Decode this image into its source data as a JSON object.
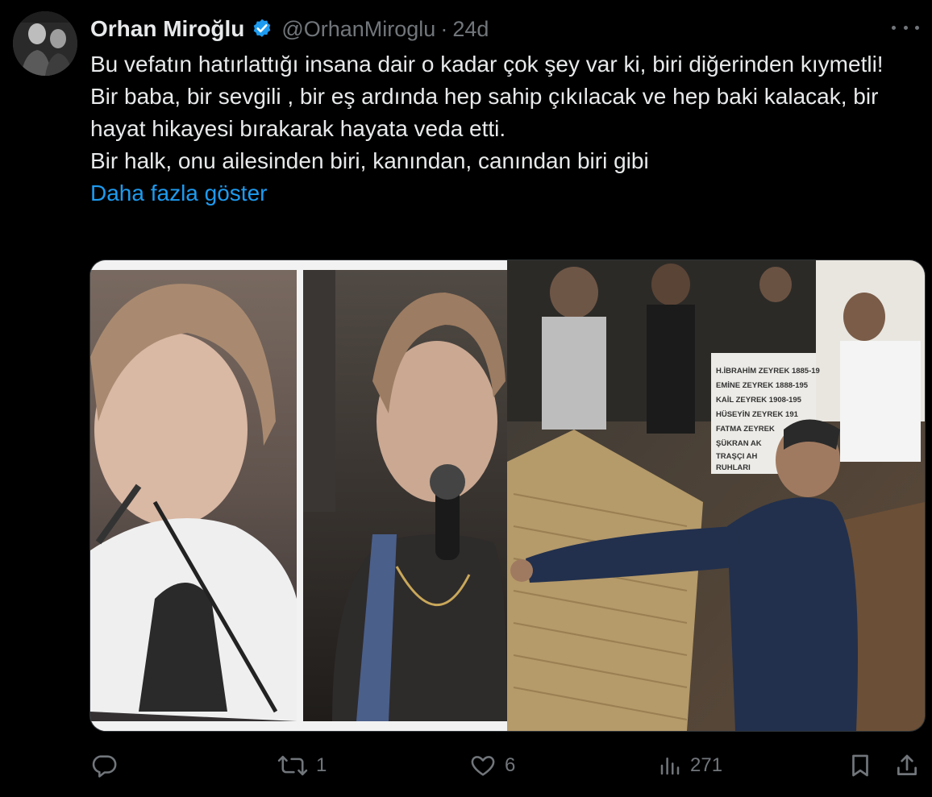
{
  "tweet": {
    "author": {
      "display_name": "Orhan Miroğlu",
      "handle": "@OrhanMiroglu",
      "verified": true
    },
    "separator": "·",
    "time": "24d",
    "text_lines": [
      "Bu vefatın hatırlattığı insana dair o kadar çok şey var ki, biri diğerinden kıymetli!",
      "Bir baba, bir sevgili , bir eş ardında hep sahip çıkılacak ve hep baki kalacak, bir hayat hikayesi bırakarak hayata veda etti.",
      "Bir halk, onu ailesinden biri, kanından, canından biri gibi"
    ],
    "show_more_label": "Daha fazla göster",
    "media": {
      "gravestone_lines": [
        "H.İBRAHİM ZEYREK 1885-19",
        "EMİNE ZEYREK 1888-195",
        "KAİL ZEYREK 1908-195",
        "HÜSEYİN ZEYREK 191",
        "FATMA ZEYREK",
        "ŞÜKRAN AK",
        "TRAŞÇI AH",
        "RUHLARI"
      ]
    },
    "metrics": {
      "replies": "",
      "reposts": "1",
      "likes": "6",
      "views": "271"
    }
  },
  "icons": {
    "reply": "reply-icon",
    "repost": "repost-icon",
    "like": "heart-icon",
    "views": "analytics-icon",
    "bookmark": "bookmark-icon",
    "share": "share-icon",
    "more": "more-icon",
    "verified": "verified-badge-icon"
  },
  "colors": {
    "background": "#000000",
    "text": "#e7e9ea",
    "secondary": "#71767b",
    "link": "#1d9bf0",
    "verified": "#1d9bf0"
  }
}
